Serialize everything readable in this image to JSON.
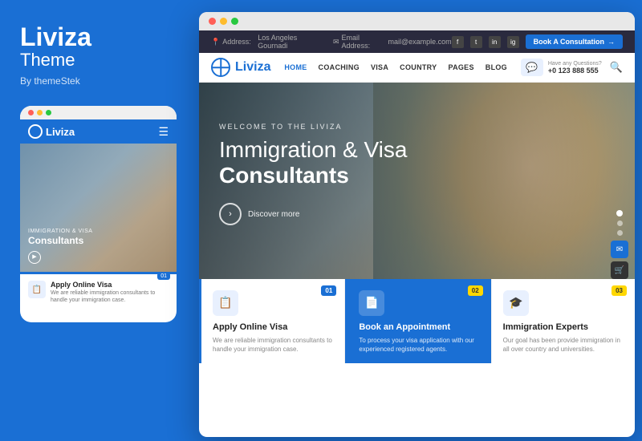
{
  "left": {
    "brand": "Liviza",
    "theme_label": "Theme",
    "credit": "By themeStek",
    "mobile": {
      "dots": [
        "red",
        "yellow",
        "green"
      ],
      "logo": "Liviza",
      "tagline": "Immigration & Visa",
      "heading": "Consultants",
      "card": {
        "num": "01",
        "title": "Apply Online Visa",
        "desc": "We are reliable immigration consultants to handle your immigration case."
      }
    }
  },
  "desktop": {
    "dots": [
      "red",
      "yellow",
      "green"
    ],
    "topbar": {
      "address_label": "Address:",
      "address": "Los Angeles Gournadi",
      "email_label": "Email Address:",
      "email": "mail@example.com",
      "book_btn": "Book A Consultation"
    },
    "nav": {
      "logo": "Liviza",
      "menu": [
        "HOME",
        "COACHING",
        "VISA",
        "COUNTRY",
        "PAGES",
        "BLOG"
      ],
      "contact_label": "Have any Questions?",
      "phone": "+0 123 888 555",
      "search_label": "search"
    },
    "hero": {
      "tagline": "WELCOME TO THE LIVIZA",
      "title_line1": "Immigration & Visa",
      "title_line2": "Consultants",
      "cta": "Discover more"
    },
    "cards": [
      {
        "num": "01",
        "icon": "📋",
        "title": "Apply Online Visa",
        "desc": "We are reliable immigration consultants to handle your immigration case."
      },
      {
        "num": "02",
        "icon": "📄",
        "title": "Book an Appointment",
        "desc": "To process your visa application with our experienced registered agents."
      },
      {
        "num": "03",
        "icon": "🎓",
        "title": "Immigration Experts",
        "desc": "Our goal has been provide immigration in all over country and universities."
      }
    ]
  }
}
